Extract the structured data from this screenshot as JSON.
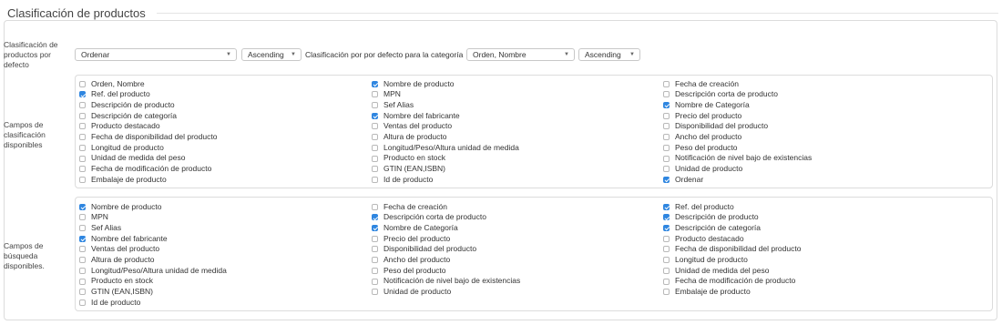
{
  "section": {
    "title": "Clasificación de productos"
  },
  "default_sort": {
    "label": "Clasificación de productos por defecto",
    "order_select": "Ordenar",
    "direction_select": "Ascending",
    "category_label": "Clasificación por por defecto para la categoría",
    "category_select": "Orden, Nombre",
    "category_direction_select": "Ascending"
  },
  "sort_fields": {
    "label": "Campos de clasificación disponibles",
    "columns": [
      [
        {
          "label": "Orden, Nombre",
          "checked": false
        },
        {
          "label": "Ref. del producto",
          "checked": true
        },
        {
          "label": "Descripción de producto",
          "checked": false
        },
        {
          "label": "Descripción de categoría",
          "checked": false
        },
        {
          "label": "Producto destacado",
          "checked": false
        },
        {
          "label": "Fecha de disponibilidad del producto",
          "checked": false
        },
        {
          "label": "Longitud de producto",
          "checked": false
        },
        {
          "label": "Unidad de medida del peso",
          "checked": false
        },
        {
          "label": "Fecha de modificación de producto",
          "checked": false
        },
        {
          "label": "Embalaje de producto",
          "checked": false
        }
      ],
      [
        {
          "label": "Nombre de producto",
          "checked": true
        },
        {
          "label": "MPN",
          "checked": false
        },
        {
          "label": "Sef Alias",
          "checked": false
        },
        {
          "label": "Nombre del fabricante",
          "checked": true
        },
        {
          "label": "Ventas del producto",
          "checked": false
        },
        {
          "label": "Altura de producto",
          "checked": false
        },
        {
          "label": "Longitud/Peso/Altura unidad de medida",
          "checked": false
        },
        {
          "label": "Producto en stock",
          "checked": false
        },
        {
          "label": "GTIN (EAN,ISBN)",
          "checked": false
        },
        {
          "label": "Id de producto",
          "checked": false
        }
      ],
      [
        {
          "label": "Fecha de creación",
          "checked": false
        },
        {
          "label": "Descripción corta de producto",
          "checked": false
        },
        {
          "label": "Nombre de Categoría",
          "checked": true
        },
        {
          "label": "Precio del producto",
          "checked": false
        },
        {
          "label": "Disponibilidad del producto",
          "checked": false
        },
        {
          "label": "Ancho del producto",
          "checked": false
        },
        {
          "label": "Peso del producto",
          "checked": false
        },
        {
          "label": "Notificación de nivel bajo de existencias",
          "checked": false
        },
        {
          "label": "Unidad de producto",
          "checked": false
        },
        {
          "label": "Ordenar",
          "checked": true
        }
      ]
    ]
  },
  "search_fields": {
    "label": "Campos de búsqueda disponibles.",
    "columns": [
      [
        {
          "label": "Nombre de producto",
          "checked": true
        },
        {
          "label": "MPN",
          "checked": false
        },
        {
          "label": "Sef Alias",
          "checked": false
        },
        {
          "label": "Nombre del fabricante",
          "checked": true
        },
        {
          "label": "Ventas del producto",
          "checked": false
        },
        {
          "label": "Altura de producto",
          "checked": false
        },
        {
          "label": "Longitud/Peso/Altura unidad de medida",
          "checked": false
        },
        {
          "label": "Producto en stock",
          "checked": false
        },
        {
          "label": "GTIN (EAN,ISBN)",
          "checked": false
        },
        {
          "label": "Id de producto",
          "checked": false
        }
      ],
      [
        {
          "label": "Fecha de creación",
          "checked": false
        },
        {
          "label": "Descripción corta de producto",
          "checked": true
        },
        {
          "label": "Nombre de Categoría",
          "checked": true
        },
        {
          "label": "Precio del producto",
          "checked": false
        },
        {
          "label": "Disponibilidad del producto",
          "checked": false
        },
        {
          "label": "Ancho del producto",
          "checked": false
        },
        {
          "label": "Peso del producto",
          "checked": false
        },
        {
          "label": "Notificación de nivel bajo de existencias",
          "checked": false
        },
        {
          "label": "Unidad de producto",
          "checked": false
        }
      ],
      [
        {
          "label": "Ref. del producto",
          "checked": true
        },
        {
          "label": "Descripción de producto",
          "checked": true
        },
        {
          "label": "Descripción de categoría",
          "checked": true
        },
        {
          "label": "Producto destacado",
          "checked": false
        },
        {
          "label": "Fecha de disponibilidad del producto",
          "checked": false
        },
        {
          "label": "Longitud de producto",
          "checked": false
        },
        {
          "label": "Unidad de medida del peso",
          "checked": false
        },
        {
          "label": "Fecha de modificación de producto",
          "checked": false
        },
        {
          "label": "Embalaje de producto",
          "checked": false
        }
      ]
    ]
  },
  "colors": {
    "accent": "#2f86e0",
    "border": "#dcdcdc"
  }
}
